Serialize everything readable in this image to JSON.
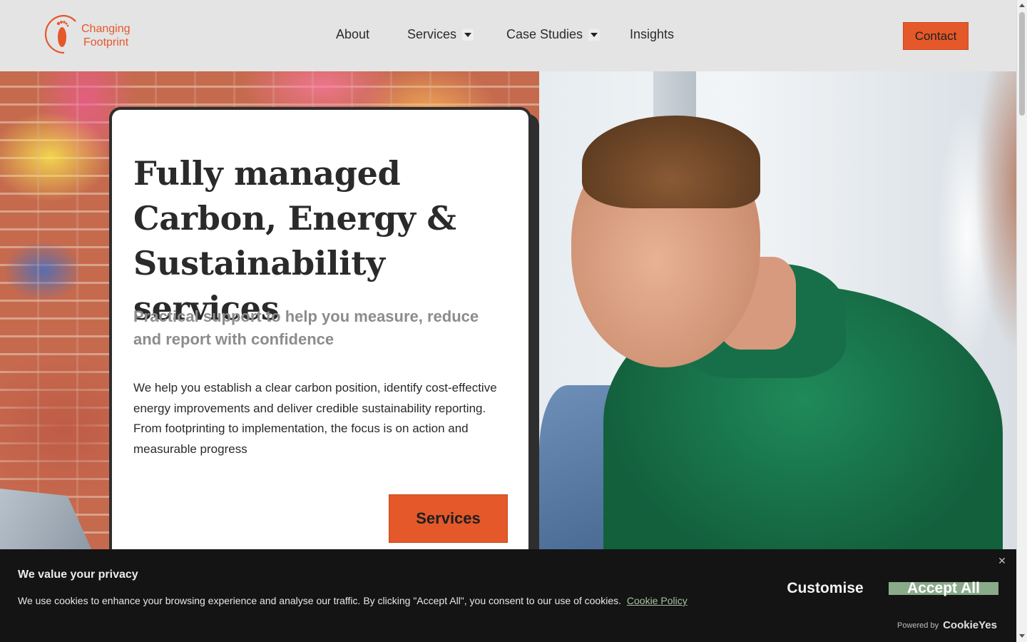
{
  "brand": {
    "line1": "Changing",
    "line2": "Footprint",
    "accent_color": "#e4582a"
  },
  "nav": {
    "items": [
      {
        "label": "About",
        "has_dropdown": false
      },
      {
        "label": "Services",
        "has_dropdown": true
      },
      {
        "label": "Case Studies",
        "has_dropdown": true
      },
      {
        "label": "Insights",
        "has_dropdown": false
      }
    ],
    "contact_label": "Contact"
  },
  "hero": {
    "title": "Fully managed Carbon, Energy & Sustainability services",
    "subtitle": "Practical support to help you measure, reduce and report with confidence",
    "body": "We help you establish a clear carbon position, identify cost-effective energy improvements and deliver credible sustainability reporting. From footprinting to implementation, the focus is on action and measurable progress",
    "cta_label": "Services"
  },
  "cookie_banner": {
    "title": "We value your privacy",
    "text": "We use cookies to enhance your browsing experience and analyse our traffic. By clicking \"Accept All\", you consent to our use of cookies.",
    "policy_link": "Cookie Policy",
    "customise_label": "Customise",
    "accept_label": "Accept All",
    "close_icon": "close-icon",
    "powered_by_label": "Powered by",
    "powered_by_brand": "CookieYes",
    "accept_color": "#8aab8a"
  }
}
